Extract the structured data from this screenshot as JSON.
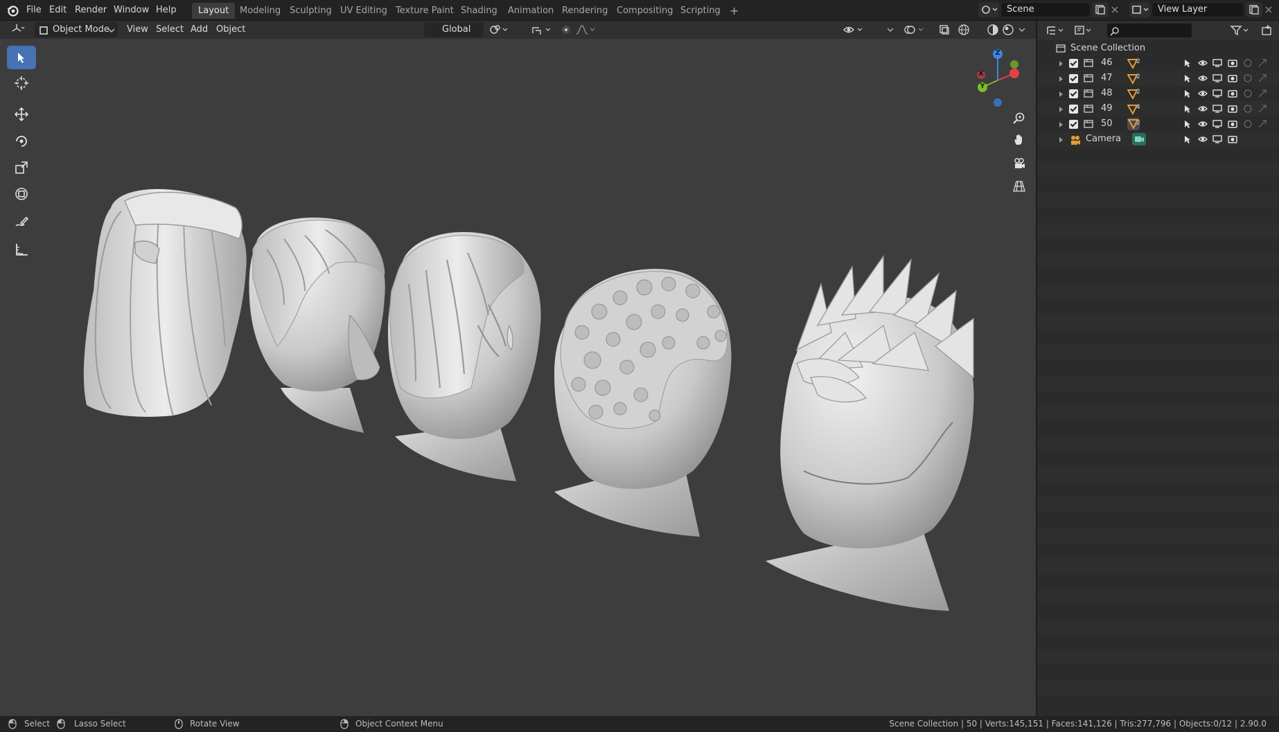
{
  "menu": {
    "items": [
      "File",
      "Edit",
      "Render",
      "Window",
      "Help"
    ]
  },
  "workspaces": {
    "tabs": [
      "Layout",
      "Modeling",
      "Sculpting",
      "UV Editing",
      "Texture Paint",
      "Shading",
      "Animation",
      "Rendering",
      "Compositing",
      "Scripting"
    ],
    "active": "Layout",
    "add": "+"
  },
  "scene": {
    "name": "Scene"
  },
  "view_layer": {
    "name": "View Layer"
  },
  "viewport_header": {
    "mode": "Object Mode",
    "menus": [
      "View",
      "Select",
      "Add",
      "Object"
    ],
    "orientation": "Global"
  },
  "gizmo": {
    "z": "Z",
    "y": "Y",
    "x": "X"
  },
  "outliner": {
    "root": "Scene Collection",
    "search_placeholder": "",
    "items": [
      {
        "name": "46",
        "badge": "2"
      },
      {
        "name": "47",
        "badge": "2"
      },
      {
        "name": "48",
        "badge": "2"
      },
      {
        "name": "49",
        "badge": "4"
      },
      {
        "name": "50",
        "badge": "2"
      }
    ],
    "camera": {
      "name": "Camera"
    }
  },
  "status": {
    "select": "Select",
    "lasso": "Lasso Select",
    "rotate": "Rotate View",
    "context": "Object Context Menu",
    "info": "Scene Collection | 50 | Verts:145,151 | Faces:141,126 | Tris:277,796 | Objects:0/12 | 2.90.0"
  },
  "colors": {
    "accent": "#4772b3",
    "viewport_bg": "#3d3d3d",
    "mesh_icon": "#e59a3c",
    "x_axis": "#e5404a",
    "y_axis": "#7ebf24",
    "z_axis": "#3c86e8"
  }
}
